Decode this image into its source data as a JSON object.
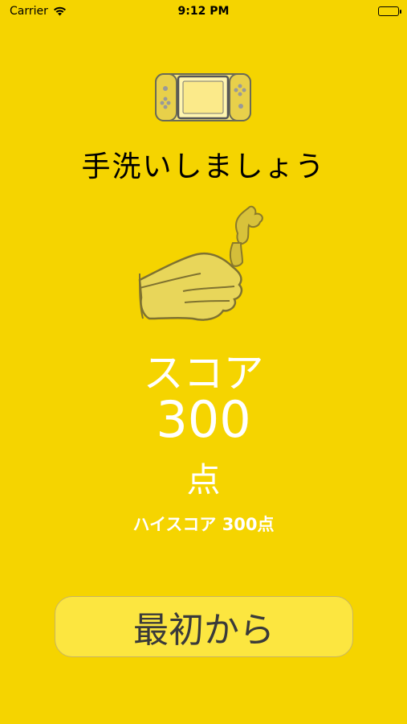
{
  "status": {
    "carrier": "Carrier",
    "time": "9:12 PM"
  },
  "title": "手洗いしましょう",
  "score": {
    "label": "スコア",
    "value": "300",
    "unit": "点"
  },
  "high_score": "ハイスコア 300点",
  "restart_button": {
    "label": "最初から"
  },
  "icons": [
    "wifi-icon",
    "battery-icon",
    "game-console-icon",
    "hand-washing-icon"
  ],
  "colors": {
    "background": "#F5D400",
    "button": "#FCE640",
    "text_light": "#FFFFFF"
  }
}
